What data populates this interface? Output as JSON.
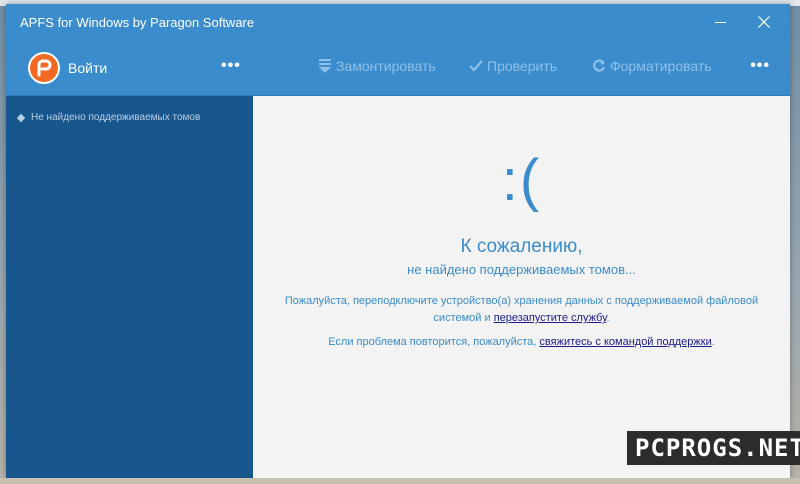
{
  "window": {
    "title": "APFS for Windows by Paragon Software"
  },
  "toolbar": {
    "login_label": "Войти",
    "more_label": "•••",
    "mount_label": "Замонтировать",
    "check_label": "Проверить",
    "format_label": "Форматировать"
  },
  "sidebar": {
    "items": [
      {
        "label": "Не найдено поддерживаемых томов"
      }
    ]
  },
  "main": {
    "emoticon": ":(",
    "heading": "К сожалению,",
    "subheading": "не найдено поддерживаемых томов...",
    "para1_before": "Пожалуйста, переподключите устройство(а) хранения данных с поддерживаемой файловой системой и ",
    "para1_link": "перезапустите службу",
    "para1_after": ".",
    "para2_before": "Если проблема повторится, пожалуйста, ",
    "para2_link": "свяжитесь с командой поддержки",
    "para2_after": "."
  },
  "watermark": "PCPROGS.NET",
  "colors": {
    "accent": "#3a8ccd",
    "sidebar": "#18568e",
    "logo": "#f26a22",
    "link": "#1a1a8c"
  },
  "icons": [
    "paragon-logo-icon",
    "mount-icon",
    "check-icon",
    "format-icon",
    "minimize-icon",
    "close-icon"
  ]
}
